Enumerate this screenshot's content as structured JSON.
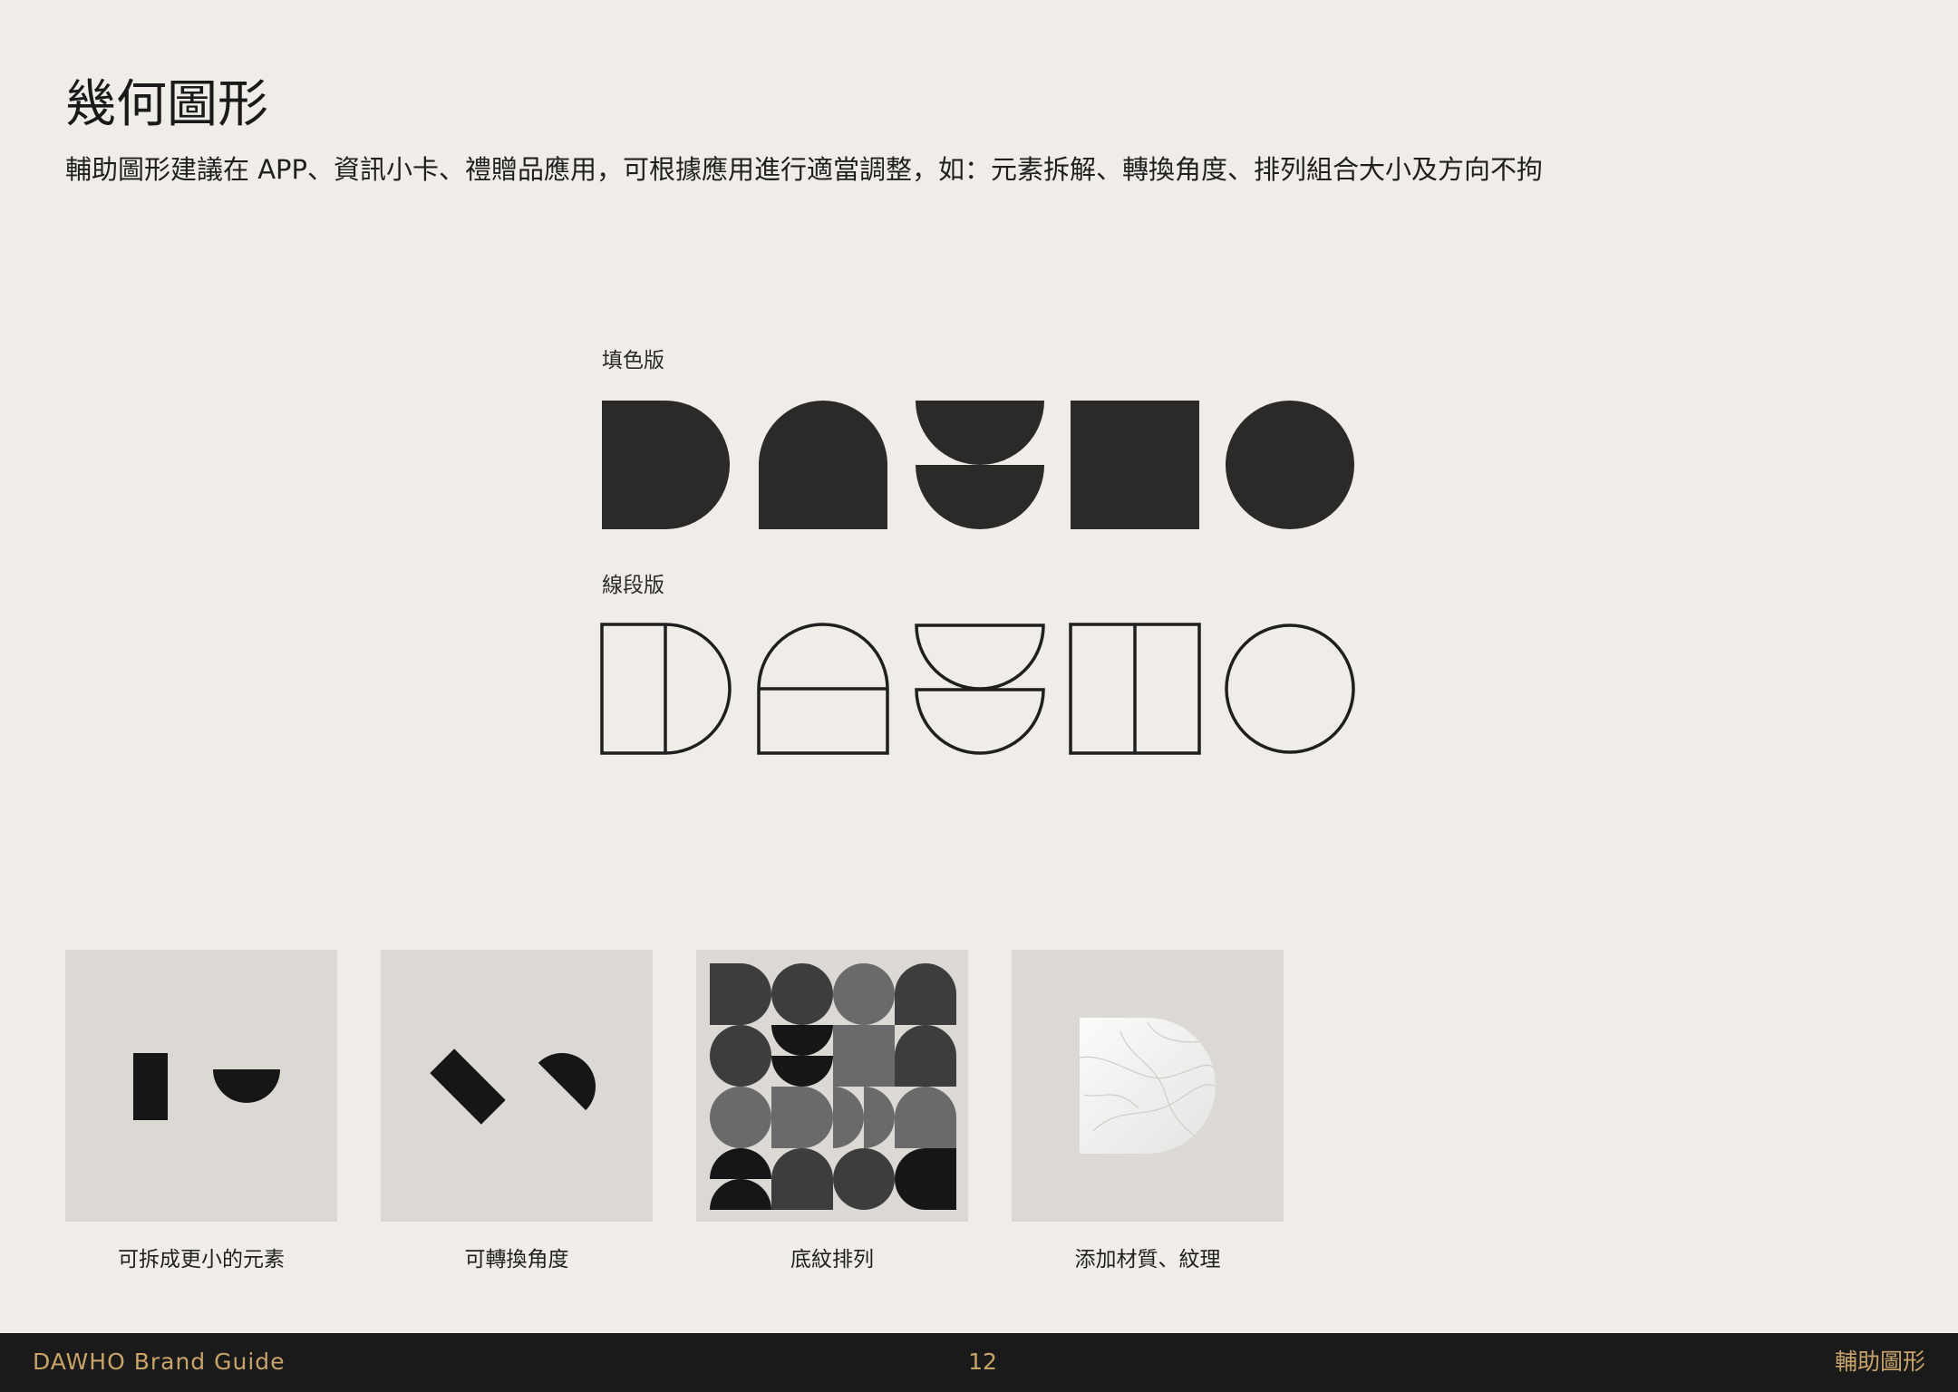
{
  "title": "幾何圖形",
  "subtitle": "輔助圖形建議在 APP、資訊小卡、禮贈品應用，可根據應用進行適當調整，如：元素拆解、轉換角度、排列組合大小及方向不拘",
  "sections": {
    "fill_label": "填色版",
    "line_label": "線段版"
  },
  "cards": [
    {
      "caption": "可拆成更小的元素"
    },
    {
      "caption": "可轉換角度"
    },
    {
      "caption": "底紋排列"
    },
    {
      "caption": "添加材質、紋理"
    }
  ],
  "footer": {
    "brand": "DAWHO Brand Guide",
    "page_number": "12",
    "section": "輔助圖形"
  },
  "colors": {
    "background": "#f0ede8",
    "ink": "#2a2a2a",
    "card": "#dcd9d4",
    "footer_bg": "#1a1a1a",
    "footer_text": "#c9a46a"
  }
}
